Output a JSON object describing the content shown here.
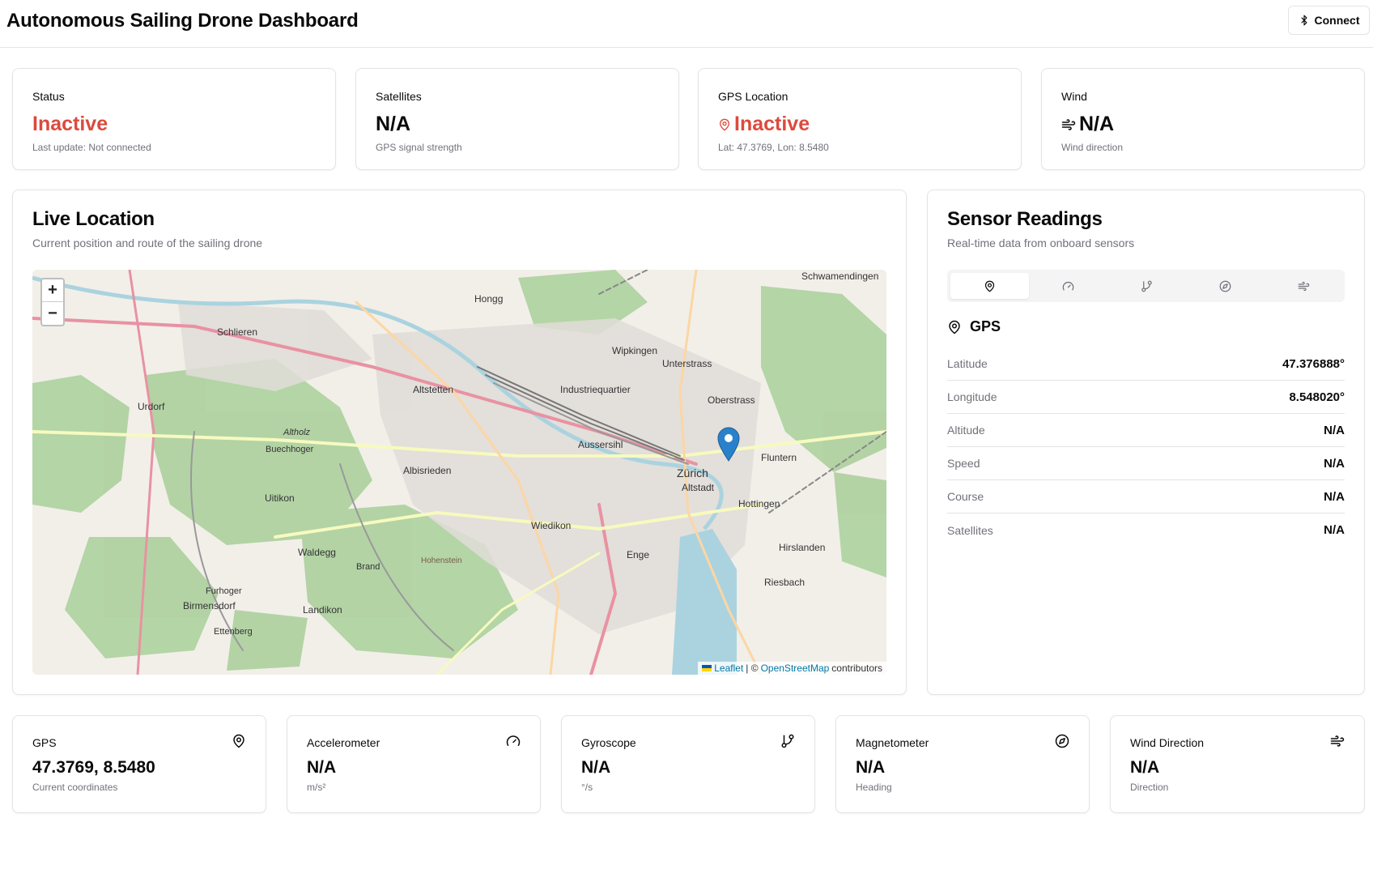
{
  "header": {
    "title": "Autonomous Sailing Drone Dashboard",
    "connect_label": "Connect"
  },
  "stats": {
    "status": {
      "label": "Status",
      "value": "Inactive",
      "sub": "Last update: Not connected"
    },
    "satellites": {
      "label": "Satellites",
      "value": "N/A",
      "sub": "GPS signal strength"
    },
    "gps": {
      "label": "GPS Location",
      "value": "Inactive",
      "sub": "Lat: 47.3769, Lon: 8.5480"
    },
    "wind": {
      "label": "Wind",
      "value": "N/A",
      "sub": "Wind direction"
    }
  },
  "map_panel": {
    "title": "Live Location",
    "description": "Current position and route of the sailing drone",
    "zoom_in": "+",
    "zoom_out": "−",
    "attribution": {
      "leaflet": "Leaflet",
      "sep": "| ©",
      "osm": "OpenStreetMap",
      "contributors": "contributors"
    },
    "places": [
      "Schlieren",
      "Hongg",
      "Wipkingen",
      "Unterstrass",
      "Oberstrass",
      "Altstetten",
      "Industriequartier",
      "Aussersihl",
      "Albisrieden",
      "Zürich",
      "Altstadt",
      "Fluntern",
      "Hottingen",
      "Wiedikon",
      "Enge",
      "Hirslanden",
      "Riesbach",
      "Uitikon",
      "Waldegg",
      "Birmensdorf",
      "Landikon",
      "Urdorf",
      "Schwamendingen",
      "Furhoger",
      "Brand",
      "Ettenberg",
      "Altholz",
      "Buechhoger",
      "Hohenstein"
    ]
  },
  "sensor_panel": {
    "title": "Sensor Readings",
    "description": "Real-time data from onboard sensors",
    "tabs": [
      "gps-icon",
      "gauge-icon",
      "gyroscope-icon",
      "compass-icon",
      "wind-icon"
    ],
    "section_title": "GPS",
    "rows": [
      {
        "key": "Latitude",
        "value": "47.376888°"
      },
      {
        "key": "Longitude",
        "value": "8.548020°"
      },
      {
        "key": "Altitude",
        "value": "N/A"
      },
      {
        "key": "Speed",
        "value": "N/A"
      },
      {
        "key": "Course",
        "value": "N/A"
      },
      {
        "key": "Satellites",
        "value": "N/A"
      }
    ]
  },
  "bottom_cards": [
    {
      "label": "GPS",
      "value": "47.3769, 8.5480",
      "sub": "Current coordinates",
      "icon": "map-pin-icon"
    },
    {
      "label": "Accelerometer",
      "value": "N/A",
      "sub": "m/s²",
      "icon": "gauge-icon"
    },
    {
      "label": "Gyroscope",
      "value": "N/A",
      "sub": "°/s",
      "icon": "gyroscope-icon"
    },
    {
      "label": "Magnetometer",
      "value": "N/A",
      "sub": "Heading",
      "icon": "compass-icon"
    },
    {
      "label": "Wind Direction",
      "value": "N/A",
      "sub": "Direction",
      "icon": "wind-icon"
    }
  ],
  "colors": {
    "inactive": "#dc4a3d",
    "muted": "#71717a",
    "border": "#e4e4e7",
    "marker": "#2a81cb"
  }
}
